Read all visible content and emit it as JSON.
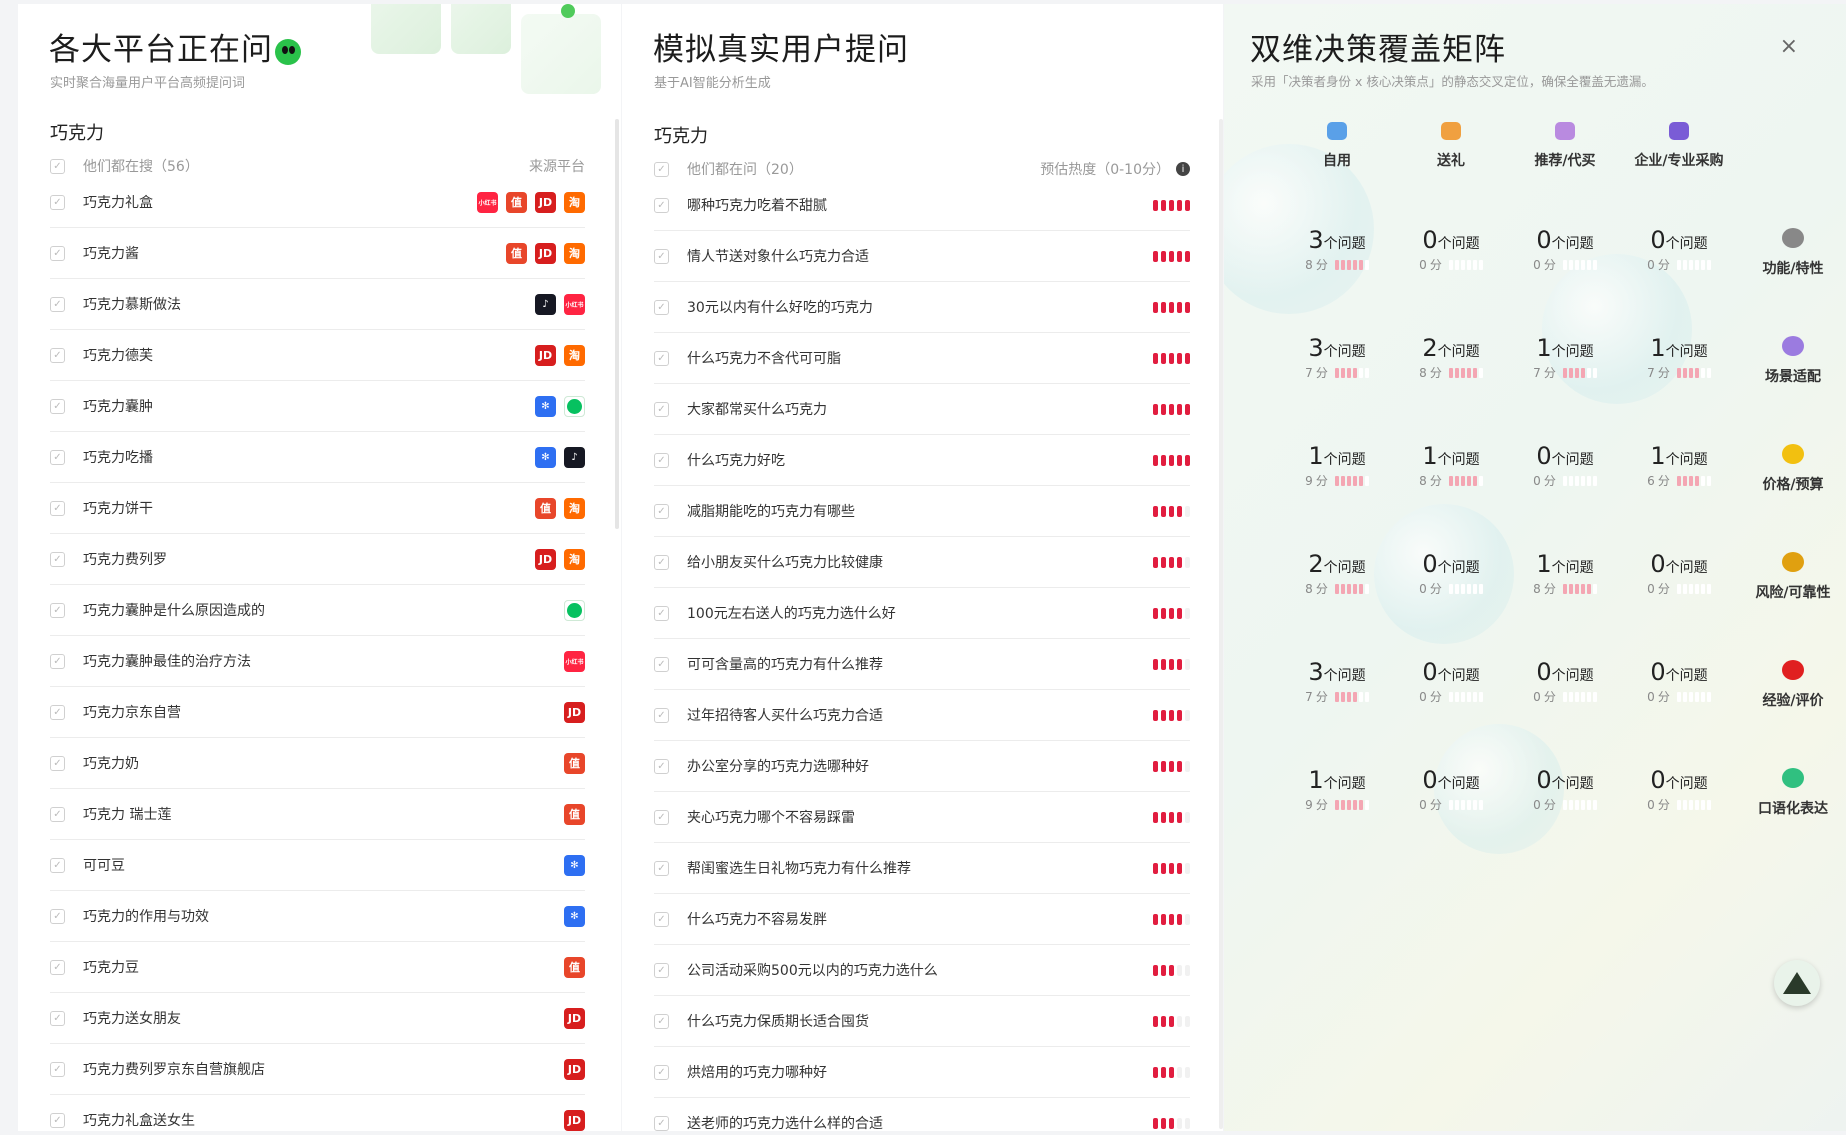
{
  "platforms_panel": {
    "title": "各大平台正在问",
    "subtitle": "实时聚合海量用户平台高频提问词",
    "section": "巧克力",
    "header_left": "他们都在搜（56）",
    "header_right": "来源平台",
    "items": [
      {
        "label": "巧克力礼盒",
        "icons": [
          "xhs",
          "zhi",
          "jd",
          "tb"
        ]
      },
      {
        "label": "巧克力酱",
        "icons": [
          "zhi",
          "jd",
          "tb"
        ]
      },
      {
        "label": "巧克力慕斯做法",
        "icons": [
          "dy",
          "xhs"
        ]
      },
      {
        "label": "巧克力德芙",
        "icons": [
          "jd",
          "tb"
        ]
      },
      {
        "label": "巧克力囊肿",
        "icons": [
          "bd",
          "wx"
        ]
      },
      {
        "label": "巧克力吃播",
        "icons": [
          "bd",
          "dy"
        ]
      },
      {
        "label": "巧克力饼干",
        "icons": [
          "zhi",
          "tb"
        ]
      },
      {
        "label": "巧克力费列罗",
        "icons": [
          "jd",
          "tb"
        ]
      },
      {
        "label": "巧克力囊肿是什么原因造成的",
        "icons": [
          "wx"
        ]
      },
      {
        "label": "巧克力囊肿最佳的治疗方法",
        "icons": [
          "xhs"
        ]
      },
      {
        "label": "巧克力京东自营",
        "icons": [
          "jd"
        ]
      },
      {
        "label": "巧克力奶",
        "icons": [
          "zhi"
        ]
      },
      {
        "label": "巧克力 瑞士莲",
        "icons": [
          "zhi"
        ]
      },
      {
        "label": "可可豆",
        "icons": [
          "bd"
        ]
      },
      {
        "label": "巧克力的作用与功效",
        "icons": [
          "bd"
        ]
      },
      {
        "label": "巧克力豆",
        "icons": [
          "zhi"
        ]
      },
      {
        "label": "巧克力送女朋友",
        "icons": [
          "jd"
        ]
      },
      {
        "label": "巧克力费列罗京东自营旗舰店",
        "icons": [
          "jd"
        ]
      },
      {
        "label": "巧克力礼盒送女生",
        "icons": [
          "jd"
        ]
      }
    ],
    "icon_text": {
      "xhs": "小红书",
      "zhi": "值",
      "jd": "JD",
      "tb": "淘",
      "dy": "♪",
      "bd": "✻",
      "wx": ""
    }
  },
  "questions_panel": {
    "title": "模拟真实用户提问",
    "subtitle": "基于AI智能分析生成",
    "section": "巧克力",
    "header_left": "他们都在问（20）",
    "header_right": "预估热度（0-10分）",
    "items": [
      {
        "label": "哪种巧克力吃着不甜腻",
        "heat": 10
      },
      {
        "label": "情人节送对象什么巧克力合适",
        "heat": 10
      },
      {
        "label": "30元以内有什么好吃的巧克力",
        "heat": 9.5
      },
      {
        "label": "什么巧克力不含代可可脂",
        "heat": 9.5
      },
      {
        "label": "大家都常买什么巧克力",
        "heat": 9.5
      },
      {
        "label": "什么巧克力好吃",
        "heat": 9.5
      },
      {
        "label": "减脂期能吃的巧克力有哪些",
        "heat": 8
      },
      {
        "label": "给小朋友买什么巧克力比较健康",
        "heat": 8
      },
      {
        "label": "100元左右送人的巧克力选什么好",
        "heat": 8
      },
      {
        "label": "可可含量高的巧克力有什么推荐",
        "heat": 8
      },
      {
        "label": "过年招待客人买什么巧克力合适",
        "heat": 8
      },
      {
        "label": "办公室分享的巧克力选哪种好",
        "heat": 7.5
      },
      {
        "label": "夹心巧克力哪个不容易踩雷",
        "heat": 7.5
      },
      {
        "label": "帮闺蜜选生日礼物巧克力有什么推荐",
        "heat": 7.5
      },
      {
        "label": "什么巧克力不容易发胖",
        "heat": 7.5
      },
      {
        "label": "公司活动采购500元以内的巧克力选什么",
        "heat": 6
      },
      {
        "label": "什么巧克力保质期长适合囤货",
        "heat": 6
      },
      {
        "label": "烘焙用的巧克力哪种好",
        "heat": 6
      },
      {
        "label": "送老师的巧克力选什么样的合适",
        "heat": 6
      }
    ]
  },
  "matrix_panel": {
    "title": "双维决策覆盖矩阵",
    "subtitle": "采用「决策者身份 x 核心决策点」的静态交叉定位，确保全覆盖无遗漏。",
    "close_label": "×",
    "count_unit": "个问题",
    "score_unit": "分",
    "columns": [
      {
        "label": "自用",
        "color": "#5aa0e8"
      },
      {
        "label": "送礼",
        "color": "#f0a040"
      },
      {
        "label": "推荐/代买",
        "color": "#b98ae0"
      },
      {
        "label": "企业/专业采购",
        "color": "#7a5cd6"
      }
    ],
    "rows": [
      {
        "label": "功能/特性",
        "icon": "wrench-icon",
        "color": "#888888"
      },
      {
        "label": "场景适配",
        "icon": "planet-icon",
        "color": "#9b7be0"
      },
      {
        "label": "价格/预算",
        "icon": "coin-icon",
        "color": "#f2c010"
      },
      {
        "label": "风险/可靠性",
        "icon": "warning-icon",
        "color": "#e0a010"
      },
      {
        "label": "经验/评价",
        "icon": "book-icon",
        "color": "#e02020"
      },
      {
        "label": "口语化表达",
        "icon": "chat-icon",
        "color": "#30c080"
      }
    ],
    "cells": [
      [
        {
          "count": "3",
          "score": "8",
          "level": 8
        },
        {
          "count": "0",
          "score": "0",
          "level": 0
        },
        {
          "count": "0",
          "score": "0",
          "level": 0
        },
        {
          "count": "0",
          "score": "0",
          "level": 0
        }
      ],
      [
        {
          "count": "3",
          "score": "7",
          "level": 7
        },
        {
          "count": "2",
          "score": "8",
          "level": 8
        },
        {
          "count": "1",
          "score": "7",
          "level": 7
        },
        {
          "count": "1",
          "score": "7",
          "level": 7
        }
      ],
      [
        {
          "count": "1",
          "score": "9",
          "level": 9
        },
        {
          "count": "1",
          "score": "8",
          "level": 8
        },
        {
          "count": "0",
          "score": "0",
          "level": 0
        },
        {
          "count": "1",
          "score": "6",
          "level": 6
        }
      ],
      [
        {
          "count": "2",
          "score": "8",
          "level": 8
        },
        {
          "count": "0",
          "score": "0",
          "level": 0
        },
        {
          "count": "1",
          "score": "8",
          "level": 8
        },
        {
          "count": "0",
          "score": "0",
          "level": 0
        }
      ],
      [
        {
          "count": "3",
          "score": "7",
          "level": 7
        },
        {
          "count": "0",
          "score": "0",
          "level": 0
        },
        {
          "count": "0",
          "score": "0",
          "level": 0
        },
        {
          "count": "0",
          "score": "0",
          "level": 0
        }
      ],
      [
        {
          "count": "1",
          "score": "9",
          "level": 9
        },
        {
          "count": "0",
          "score": "0",
          "level": 0
        },
        {
          "count": "0",
          "score": "0",
          "level": 0
        },
        {
          "count": "0",
          "score": "0",
          "level": 0
        }
      ]
    ]
  }
}
